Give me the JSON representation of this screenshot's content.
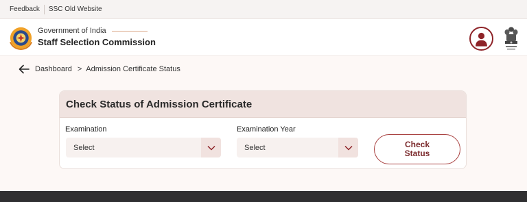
{
  "topbar": {
    "feedback_label": "Feedback",
    "old_website_label": "SSC Old Website"
  },
  "header": {
    "gov_label": "Government of India",
    "org_label": "Staff Selection Commission",
    "emblem_icon": "ssc-logo-icon",
    "avatar_icon": "user-avatar-icon",
    "national_emblem_icon": "national-emblem-icon"
  },
  "breadcrumb": {
    "back_icon": "arrow-left-icon",
    "home_label": "Dashboard",
    "separator": ">",
    "current_label": "Admission Certificate Status"
  },
  "card": {
    "title": "Check Status of Admission Certificate",
    "examination": {
      "label": "Examination",
      "value": "Select"
    },
    "year": {
      "label": "Examination Year",
      "value": "Select"
    },
    "button": {
      "line1": "Check",
      "line2": "Status"
    }
  },
  "colors": {
    "accent": "#8e2328",
    "card_header": "#f0e3e0",
    "page_bg": "#fdf8f6",
    "footer": "#2f2f31"
  }
}
